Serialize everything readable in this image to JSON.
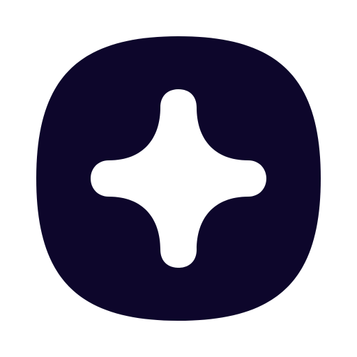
{
  "icon": {
    "name": "sparkle-app-icon",
    "background_color": "#0d062b",
    "glyph_color": "#ffffff",
    "page_background": "#ffffff"
  }
}
